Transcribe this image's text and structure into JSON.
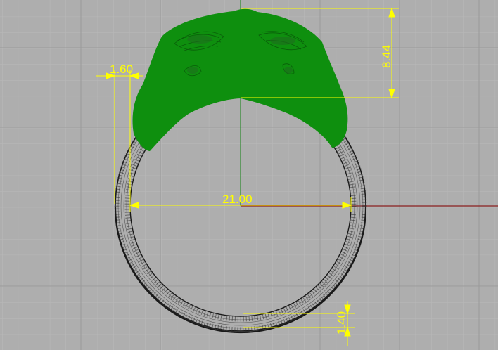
{
  "viewport": {
    "background_color": "#aeaeae",
    "grid_minor_color": "#b9b9b9",
    "grid_major_color": "#9a9a9a",
    "axis_x_color": "#8a2020",
    "axis_y_color": "#2c8a2c",
    "ring_wire_color": "#1a1a1a",
    "head_color": "#0e8f0e",
    "dimension_color": "#ffff00"
  },
  "dimensions": {
    "head_height": "8.44",
    "wall_thickness": "1.60",
    "inner_diameter": "21.00",
    "band_thickness": "1.40"
  }
}
